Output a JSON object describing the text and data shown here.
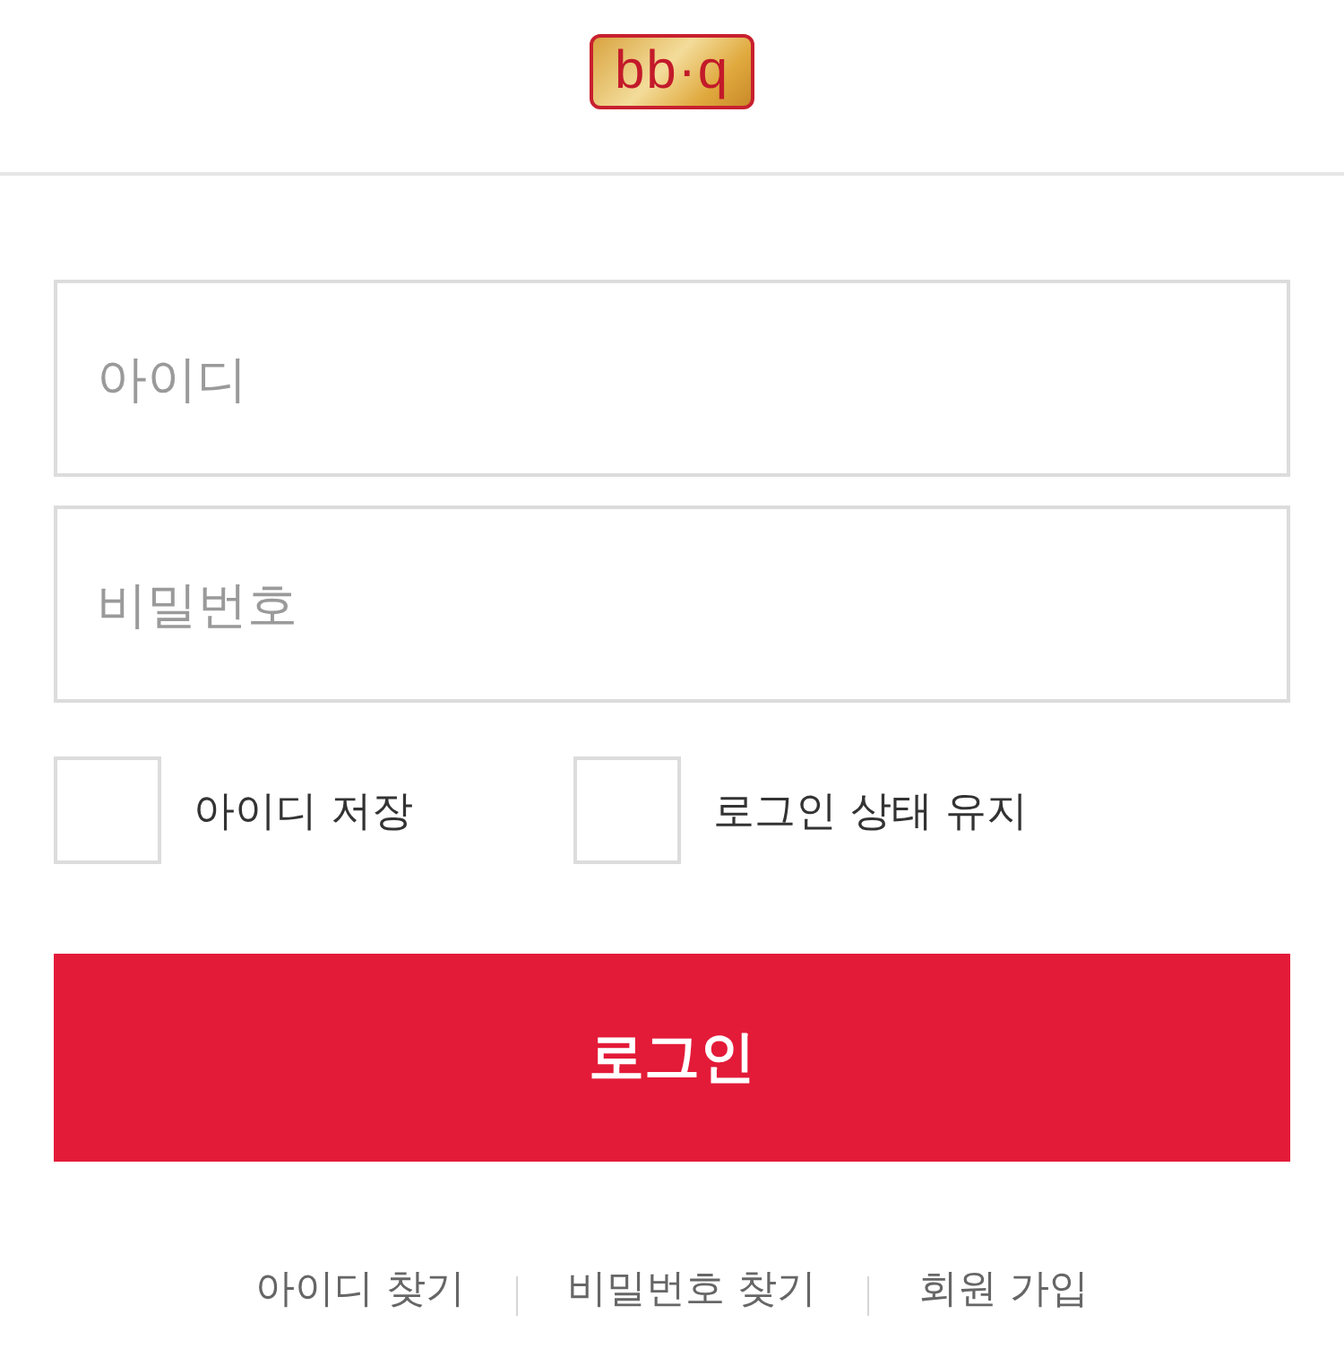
{
  "header": {
    "logo": {
      "text": "bb·q"
    }
  },
  "form": {
    "fields": [
      {
        "placeholder": "아이디"
      },
      {
        "placeholder": "비밀번호"
      }
    ],
    "options": [
      {
        "label": "아이디 저장",
        "checked": false
      },
      {
        "label": "로그인 상태 유지",
        "checked": false
      }
    ],
    "submit": {
      "label": "로그인"
    }
  },
  "links": [
    "아이디 찾기",
    "비밀번호 찾기",
    "회원 가입"
  ]
}
